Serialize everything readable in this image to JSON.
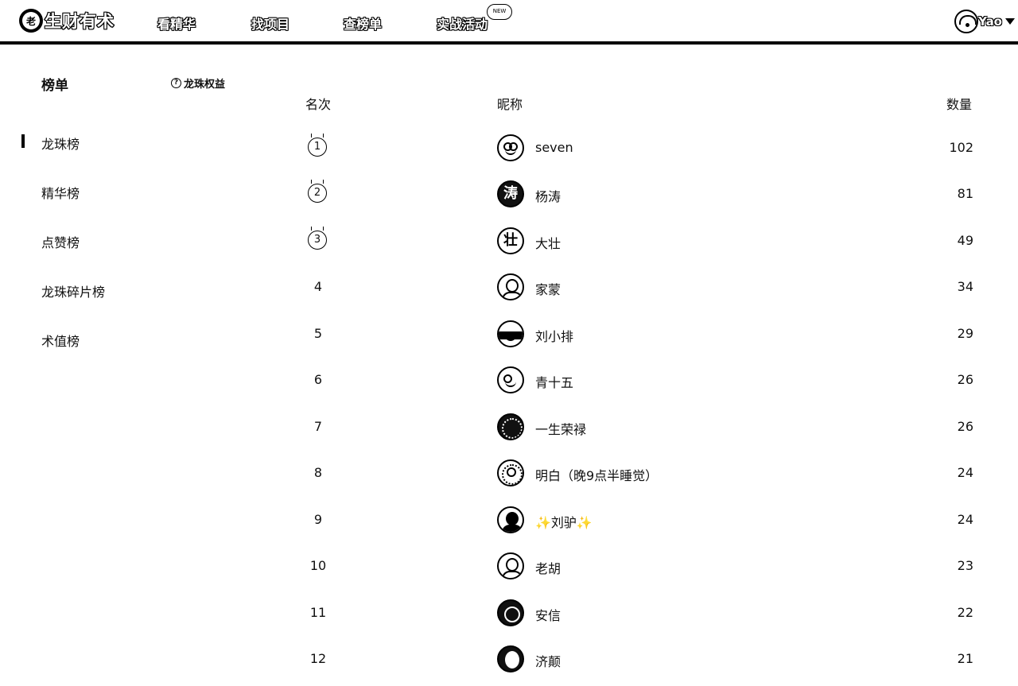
{
  "nav": {
    "logo_mark": "老",
    "logo_text": "生财有术",
    "items": [
      "看精华",
      "找项目",
      "查榜单",
      "实战活动"
    ],
    "badge": "NEW",
    "user_name": "Yao"
  },
  "sidebar": {
    "title": "榜单",
    "benefits_label": "龙珠权益",
    "items": [
      {
        "label": "龙珠榜",
        "active": true
      },
      {
        "label": "精华榜",
        "active": false
      },
      {
        "label": "点赞榜",
        "active": false
      },
      {
        "label": "龙珠碎片榜",
        "active": false
      },
      {
        "label": "术值榜",
        "active": false
      }
    ]
  },
  "table": {
    "headers": {
      "rank": "名次",
      "nickname": "昵称",
      "count": "数量"
    },
    "rows": [
      {
        "rank": "1",
        "name": "seven",
        "count": "102",
        "avatar": "owl-face-icon"
      },
      {
        "rank": "2",
        "name": "杨涛",
        "count": "81",
        "avatar": "calligraphy-tao-icon"
      },
      {
        "rank": "3",
        "name": "大壮",
        "count": "49",
        "avatar": "calligraphy-icon"
      },
      {
        "rank": "4",
        "name": "家蒙",
        "count": "34",
        "avatar": "person-glasses-icon"
      },
      {
        "rank": "5",
        "name": "刘小排",
        "count": "29",
        "avatar": "mushroom-icon"
      },
      {
        "rank": "6",
        "name": "青十五",
        "count": "26",
        "avatar": "cartoon-face-icon"
      },
      {
        "rank": "7",
        "name": "一生荣禄",
        "count": "26",
        "avatar": "dark-photo-icon"
      },
      {
        "rank": "8",
        "name": "明白（晚9点半睡觉）",
        "count": "24",
        "avatar": "person-dotted-icon"
      },
      {
        "rank": "9",
        "name": "✨刘驴✨",
        "count": "24",
        "avatar": "person-suit-icon"
      },
      {
        "rank": "10",
        "name": "老胡",
        "count": "23",
        "avatar": "person-icon"
      },
      {
        "rank": "11",
        "name": "安信",
        "count": "22",
        "avatar": "dark-badge-icon"
      },
      {
        "rank": "12",
        "name": "济颠",
        "count": "21",
        "avatar": "portrait-icon"
      }
    ]
  }
}
